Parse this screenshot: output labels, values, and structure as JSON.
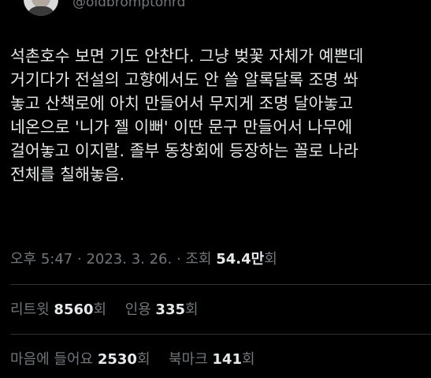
{
  "author": {
    "handle": "@oldbromptonrd"
  },
  "tweet": {
    "lines": [
      "석촌호수 보면 기도 안찬다. 그냥 벚꽃 자체가 예쁜데",
      "거기다가 전설의 고향에서도 안 쓸 알록달록 조명 쏴",
      "놓고 산책로에 아치 만들어서 무지게 조명 달아놓고",
      "네온으로 '니가 젤 이뻐' 이딴 문구 만들어서 나무에",
      "걸어놓고 이지랄. 졸부 동창회에 등장하는 꼴로 나라",
      "전체를 칠해놓음."
    ]
  },
  "meta": {
    "time": "오후 5:47",
    "separator": " · ",
    "date": "2023. 3. 26.",
    "views_label": "조회",
    "views_value": "54.4만",
    "views_suffix": "회"
  },
  "stats": {
    "retweets_label": "리트윗",
    "retweets_value": "8560",
    "retweets_suffix": "회",
    "quotes_label": "인용",
    "quotes_value": "335",
    "quotes_suffix": "회",
    "likes_label": "마음에 들어요",
    "likes_value": "2530",
    "likes_suffix": "회",
    "bookmarks_label": "북마크",
    "bookmarks_value": "141",
    "bookmarks_suffix": "회"
  },
  "colors": {
    "background": "#000000",
    "text": "#e7e9ea",
    "secondary": "#71767b",
    "divider": "#2f3336"
  }
}
